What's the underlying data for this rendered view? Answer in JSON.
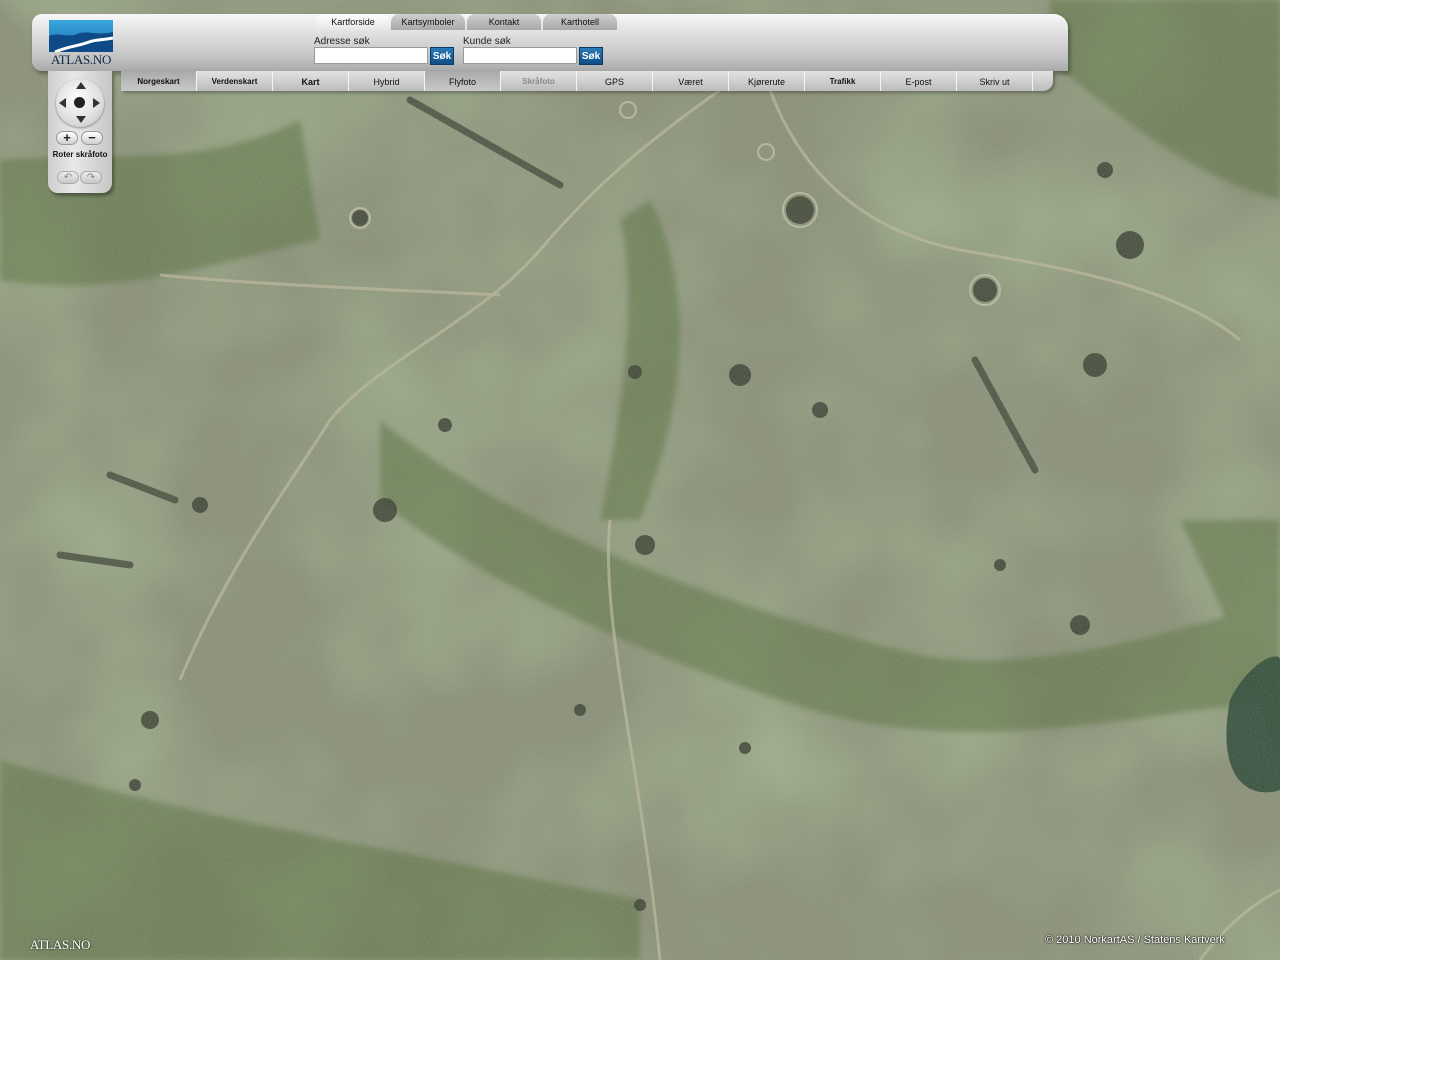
{
  "logo": {
    "text": "ATLAS.NO"
  },
  "tabs": [
    {
      "label": "Kartforside",
      "active": true
    },
    {
      "label": "Kartsymboler",
      "active": false
    },
    {
      "label": "Kontakt",
      "active": false
    },
    {
      "label": "Karthotell",
      "active": false
    }
  ],
  "search": {
    "address": {
      "label": "Adresse søk",
      "value": "",
      "button": "Søk"
    },
    "customer": {
      "label": "Kunde søk",
      "value": "",
      "button": "Søk"
    }
  },
  "modes": [
    {
      "label": "Norgeskart",
      "state": "pressed"
    },
    {
      "label": "Verdenskart",
      "state": "normal"
    },
    {
      "label": "Kart",
      "state": "normal"
    },
    {
      "label": "Hybrid",
      "state": "normal"
    },
    {
      "label": "Flyfoto",
      "state": "pressed"
    },
    {
      "label": "Skråfoto",
      "state": "disabled"
    },
    {
      "label": "GPS",
      "state": "normal"
    },
    {
      "label": "Været",
      "state": "normal"
    },
    {
      "label": "Kjørerute",
      "state": "normal"
    },
    {
      "label": "Trafikk",
      "state": "normal"
    },
    {
      "label": "E-post",
      "state": "normal"
    },
    {
      "label": "Skriv ut",
      "state": "normal"
    }
  ],
  "controls": {
    "zoom_in": "+",
    "zoom_out": "−",
    "rotate_label": "Roter skråfoto",
    "rotate_left": "↶",
    "rotate_right": "↷"
  },
  "map": {
    "type": "aerial photo",
    "watermark": "ATLAS.NO",
    "copyright": "© 2010 NorkartAS / Statens Kartverk"
  }
}
